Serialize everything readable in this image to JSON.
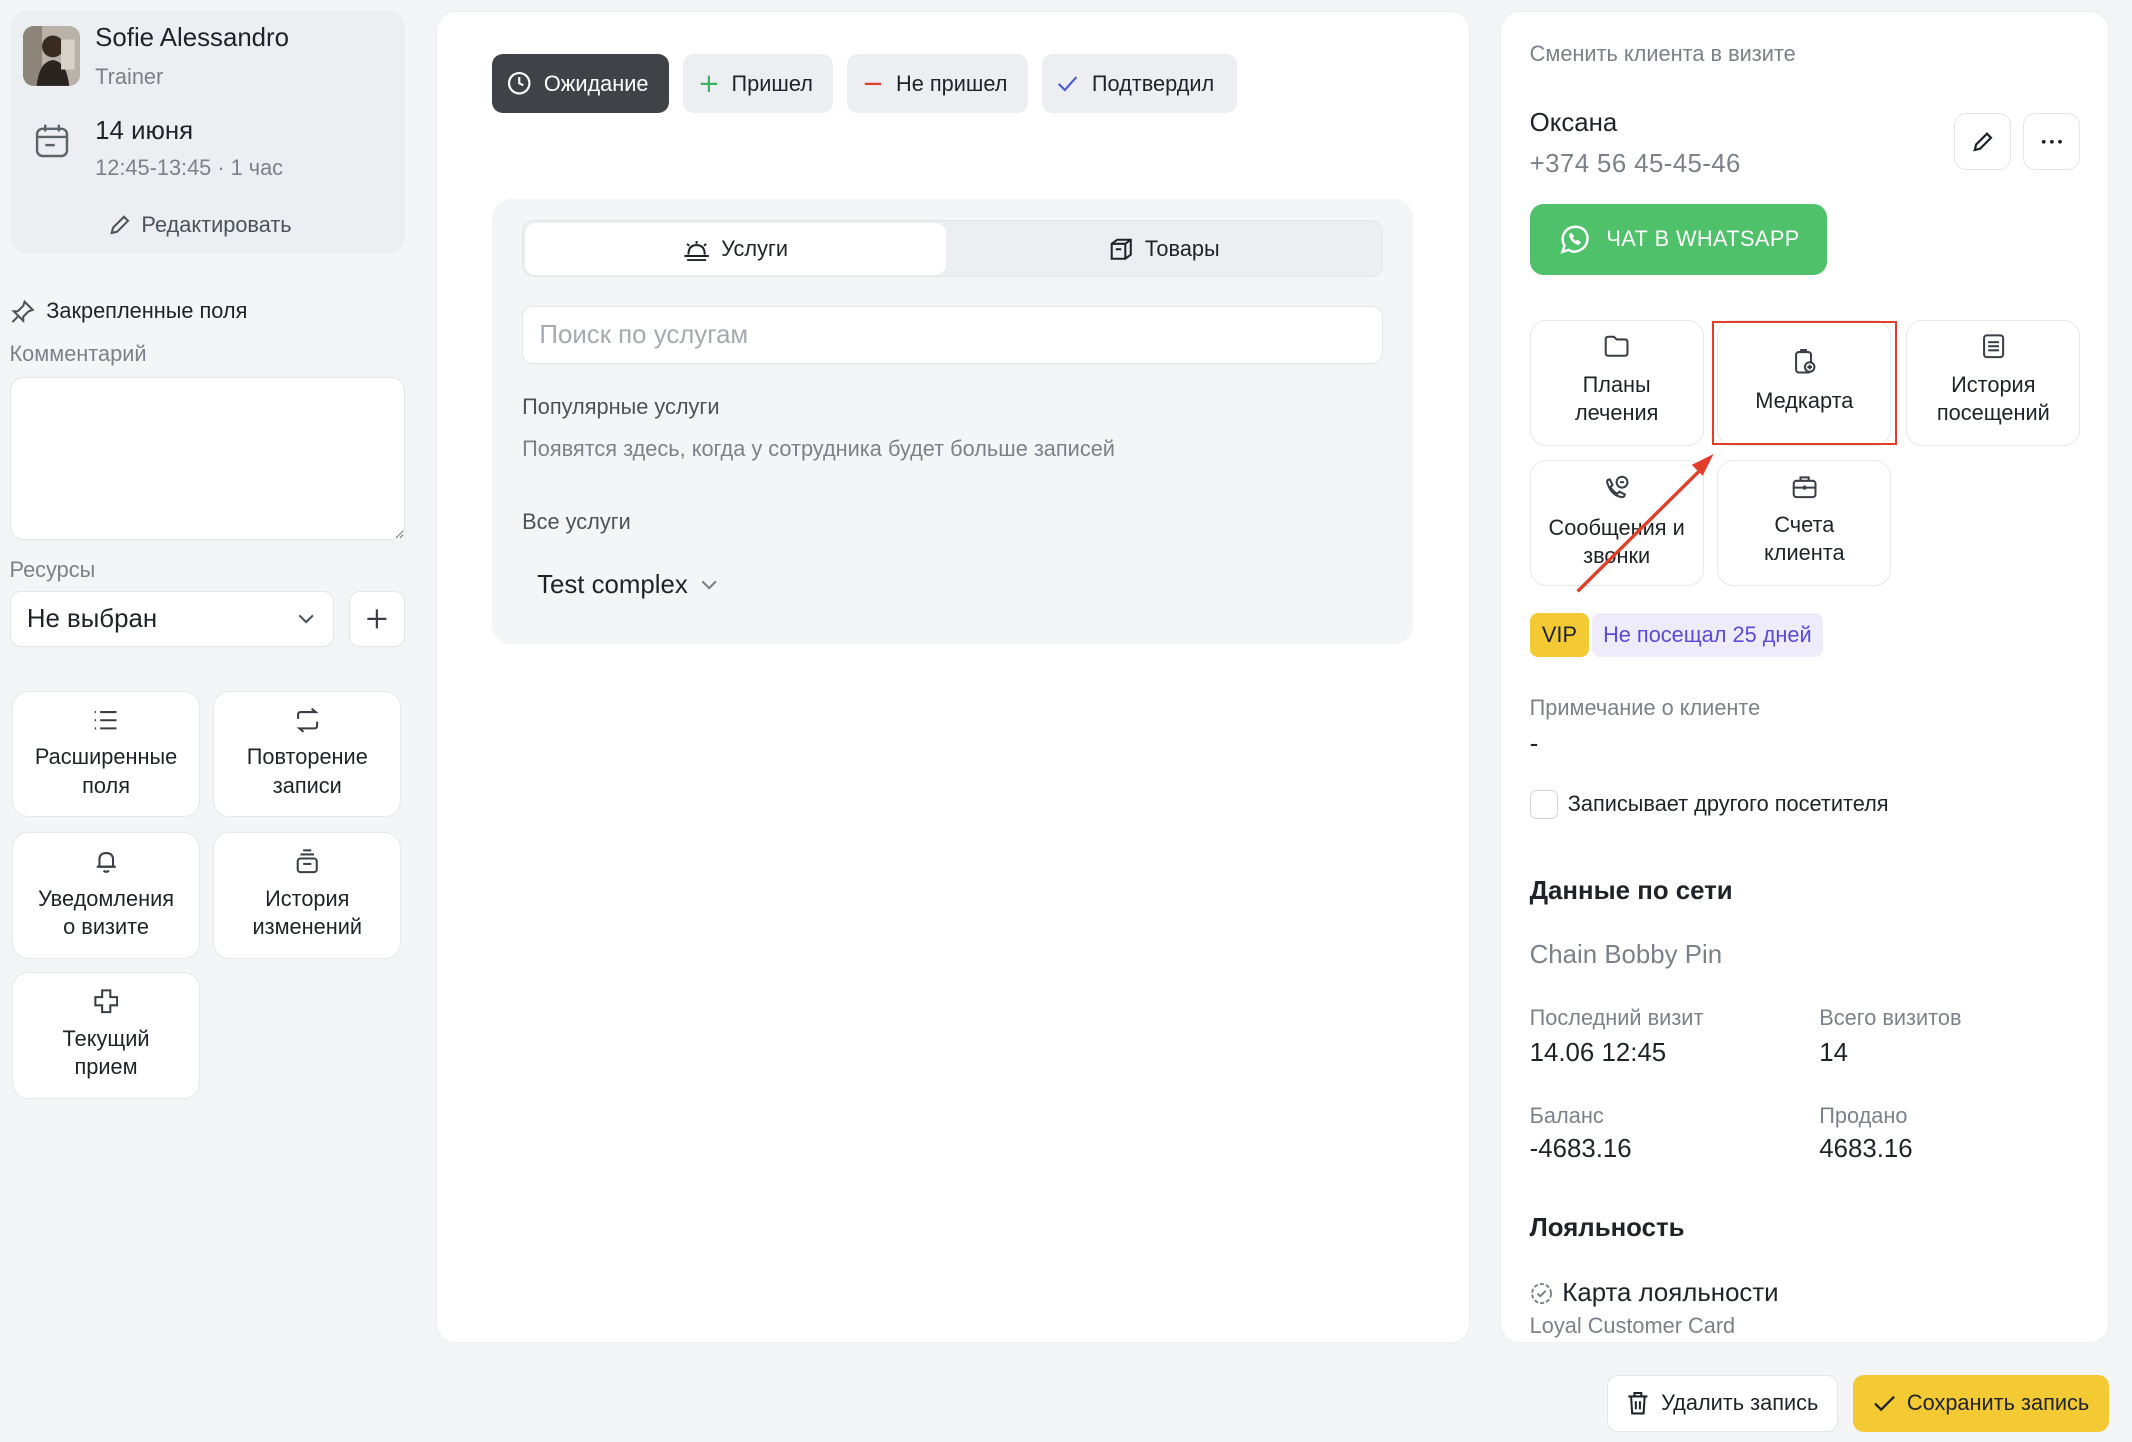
{
  "visit": {
    "trainer_name": "Sofie Alessandro",
    "trainer_role": "Trainer",
    "date": "14 июня",
    "time": "12:45-13:45 · 1 час",
    "edit_label": "Редактировать"
  },
  "left": {
    "pinned_title": "Закрепленные поля",
    "comment_label": "Комментарий",
    "resources_label": "Ресурсы",
    "resource_value": "Не выбран",
    "tiles": [
      {
        "label": "Расширенные\nполя",
        "icon": "list-icon"
      },
      {
        "label": "Повторение\nзаписи",
        "icon": "repeat-icon"
      },
      {
        "label": "Уведомления\nо визите",
        "icon": "bell-icon"
      },
      {
        "label": "История\nизменений",
        "icon": "history-stack-icon"
      },
      {
        "label": "Текущий\nприем",
        "icon": "cross-icon"
      }
    ]
  },
  "status": {
    "buttons": [
      {
        "label": "Ожидание",
        "icon": "clock-icon",
        "active": true
      },
      {
        "label": "Пришел",
        "icon": "plus-icon",
        "color": "#3bb05e"
      },
      {
        "label": "Не пришел",
        "icon": "minus-icon",
        "color": "#e0402a"
      },
      {
        "label": "Подтвердил",
        "icon": "check-icon",
        "color": "#4a5bd6"
      }
    ]
  },
  "services": {
    "tab_services": "Услуги",
    "tab_goods": "Товары",
    "search_placeholder": "Поиск по услугам",
    "popular_title": "Популярные услуги",
    "popular_subtitle": "Появятся здесь, когда у сотрудника будет больше записей",
    "all_title": "Все услуги",
    "group_name": "Test complex"
  },
  "client": {
    "change_label": "Сменить клиента в визите",
    "name": "Оксана",
    "phone": "+374 56 45-45-46",
    "whatsapp_label": "ЧАТ В WHATSAPP",
    "tiles": [
      {
        "label": "Планы\nлечения",
        "icon": "folder-icon"
      },
      {
        "label": "Медкарта",
        "icon": "medcard-icon"
      },
      {
        "label": "История\nпосещений",
        "icon": "visits-history-icon"
      },
      {
        "label": "Сообщения и\nзвонки",
        "icon": "phone-chat-icon"
      },
      {
        "label": "Счета\nклиента",
        "icon": "briefcase-icon"
      }
    ],
    "badge_vip": "VIP",
    "badge_days": "Не посещал 25 дней",
    "note_label": "Примечание о клиенте",
    "note_value": "-",
    "other_visitor_label": "Записывает другого посетителя",
    "network_title": "Данные по сети",
    "network_name": "Chain Bobby Pin",
    "last_visit_label": "Последний визит",
    "last_visit_value": "14.06 12:45",
    "total_visits_label": "Всего визитов",
    "total_visits_value": "14",
    "balance_label": "Баланс",
    "balance_value": "-4683.16",
    "sold_label": "Продано",
    "sold_value": "4683.16",
    "loyalty_title": "Лояльность",
    "loyalty_card_title": "Карта лояльности",
    "loyalty_card_name": "Loyal Customer Card"
  },
  "footer": {
    "delete_label": "Удалить запись",
    "save_label": "Сохранить запись"
  },
  "colors": {
    "accent_yellow": "#f3c934",
    "whatsapp_green": "#4fc16a",
    "annotation_red": "#e0402a"
  }
}
